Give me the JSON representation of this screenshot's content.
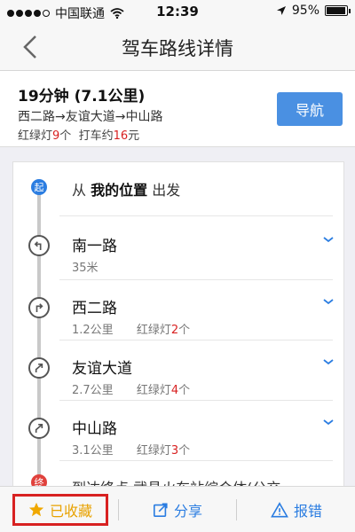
{
  "status_bar": {
    "carrier": "中国联通",
    "time": "12:39",
    "battery": "95%",
    "battery_level": 0.95,
    "signal_dots_filled": 4,
    "signal_dots_total": 5
  },
  "nav": {
    "title": "驾车路线详情"
  },
  "summary": {
    "duration": "19分钟",
    "distance": "(7.1公里)",
    "roads": "西二路→友谊大道→中山路",
    "lights_label": "红绿灯",
    "lights_count": "9",
    "lights_unit": "个",
    "taxi_label": "打车约",
    "taxi_fare": "16",
    "taxi_unit": "元",
    "navigate_label": "导航"
  },
  "route": {
    "start_badge": "起",
    "start_prefix": "从",
    "start_location": "我的位置",
    "start_suffix": "出发",
    "steps": [
      {
        "name": "南一路",
        "distance": "35米",
        "lights_label": "",
        "lights_count": "",
        "lights_unit": "",
        "turn": "left"
      },
      {
        "name": "西二路",
        "distance": "1.2公里",
        "lights_label": "红绿灯",
        "lights_count": "2",
        "lights_unit": "个",
        "turn": "right"
      },
      {
        "name": "友谊大道",
        "distance": "2.7公里",
        "lights_label": "红绿灯",
        "lights_count": "4",
        "lights_unit": "个",
        "turn": "slight-right"
      },
      {
        "name": "中山路",
        "distance": "3.1公里",
        "lights_label": "红绿灯",
        "lights_count": "3",
        "lights_unit": "个",
        "turn": "slight-right"
      }
    ],
    "end_badge": "终",
    "end_text": "到达终点 武昌火车站综合体(公交"
  },
  "toolbar": {
    "favorite_label": "已收藏",
    "share_label": "分享",
    "report_label": "报错"
  },
  "colors": {
    "accent": "#4a90e2",
    "link": "#2b7de1",
    "highlight": "#d82121",
    "favorite": "#e8a200"
  }
}
